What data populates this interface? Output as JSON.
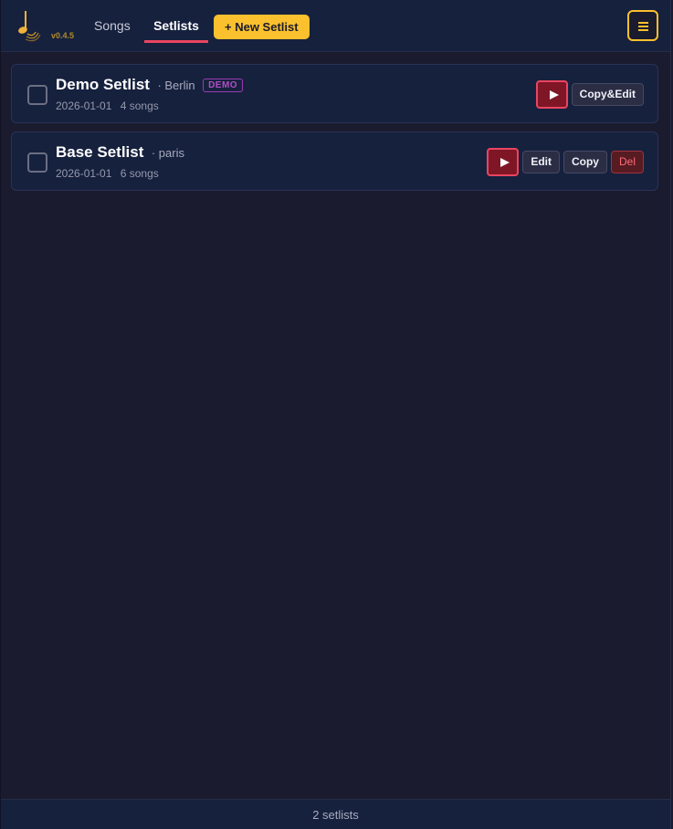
{
  "header": {
    "version": "v0.4.5",
    "tabs": {
      "songs": "Songs",
      "setlists": "Setlists"
    },
    "active_tab": "setlists",
    "new_setlist_label": "+ New Setlist",
    "menu_icon": "hamburger-icon",
    "logo_icon": "music-note-icon"
  },
  "setlists": [
    {
      "title": "Demo Setlist",
      "city": "· Berlin",
      "badge": "DEMO",
      "date": "2026-01-01",
      "songs": "4 songs",
      "actions": {
        "copy_edit": "Copy&Edit"
      }
    },
    {
      "title": "Base Setlist",
      "city": "· paris",
      "date": "2026-01-01",
      "songs": "6 songs",
      "actions": {
        "edit": "Edit",
        "copy": "Copy",
        "del": "Del"
      }
    }
  ],
  "footer": {
    "count": "2 setlists"
  },
  "colors": {
    "accent_yellow": "#fbc02d",
    "accent_red": "#e94560",
    "background": "#1a1b2e",
    "panel": "#16213e"
  }
}
